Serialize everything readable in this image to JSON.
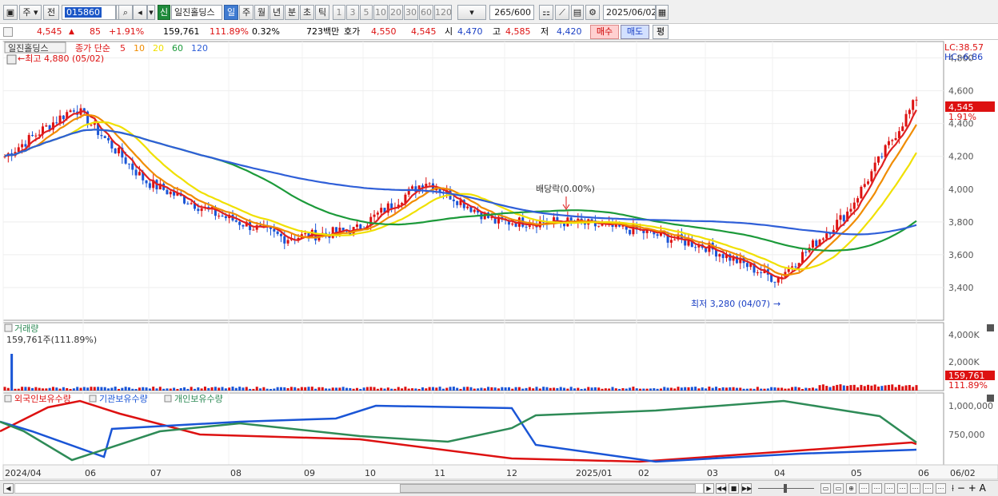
{
  "toolbar": {
    "market": "주",
    "prev_label": "전",
    "code": "015860",
    "name_badge": "신",
    "stock_name": "일진홀딩스",
    "periods": [
      "일",
      "주",
      "월",
      "년",
      "분",
      "초",
      "틱"
    ],
    "active_period": "일",
    "intervals": [
      "1",
      "3",
      "5",
      "10",
      "20",
      "30",
      "60",
      "120"
    ],
    "count": "265/600",
    "date": "2025/06/02"
  },
  "quote": {
    "price": "4,545",
    "change_arrow": "▲",
    "change": "85",
    "change_pct": "+1.91%",
    "volume": "159,761",
    "volume_ratio": "111.89%",
    "turnover": "0.32%",
    "amount": "723백만",
    "ask_label": "호가",
    "ask1": "4,550",
    "ask2": "4,545",
    "open_label": "시",
    "open": "4,470",
    "high_label": "고",
    "high": "4,585",
    "low_label": "저",
    "low": "4,420",
    "buy_label": "매수",
    "sell_label": "매도",
    "eval_label": "평"
  },
  "legend": {
    "stock": "일진홀딩스",
    "ma_title": "종가 단순",
    "ma": [
      {
        "period": "5",
        "color": "#e02020"
      },
      {
        "period": "10",
        "color": "#f08c00"
      },
      {
        "period": "20",
        "color": "#f0e000"
      },
      {
        "period": "60",
        "color": "#1c9a3a"
      },
      {
        "period": "120",
        "color": "#2f5fd8"
      }
    ]
  },
  "annotations": {
    "high": "최고 4,880 (05/02)",
    "low": "최저 3,280 (04/07)",
    "dividend": "배당락(0.00%)",
    "lc": "LC:38.57",
    "hc": "HC:-6.86",
    "price_tag": "4,545",
    "pct_tag": "1.91%"
  },
  "price_axis": [
    "4,800",
    "4,600",
    "4,400",
    "4,200",
    "4,000",
    "3,800",
    "3,600",
    "3,400"
  ],
  "volume_panel": {
    "title": "거래량",
    "value": "159,761주(111.89%)",
    "axis": [
      "4,000K",
      "2,000K"
    ],
    "tag": "159,761",
    "tag2": "111.89%"
  },
  "holding_panel": {
    "series": [
      {
        "name": "외국인보유수량",
        "color": "#d11"
      },
      {
        "name": "기관보유수량",
        "color": "#1a55d6"
      },
      {
        "name": "개인보유수량",
        "color": "#2e8b57"
      }
    ],
    "axis": [
      "1,000,000",
      "750,000"
    ]
  },
  "time_axis": [
    "2024/04",
    "06",
    "07",
    "08",
    "09",
    "10",
    "11",
    "12",
    "2025/01",
    "02",
    "03",
    "04",
    "05",
    "06",
    "06/02"
  ],
  "chart_data": {
    "type": "candlestick",
    "symbol": "일진홀딩스",
    "ylim": [
      3200,
      4900
    ],
    "x": [
      "2024/04",
      "06",
      "07",
      "08",
      "09",
      "10",
      "11",
      "12",
      "2025/01",
      "02",
      "03",
      "04",
      "05",
      "06"
    ],
    "close_approx": [
      4200,
      4500,
      4050,
      3850,
      3700,
      3750,
      4050,
      3800,
      3800,
      3750,
      3650,
      3450,
      3850,
      4545
    ],
    "high_label": {
      "value": 4880,
      "date": "05/02"
    },
    "low_label": {
      "value": 3280,
      "date": "04/07"
    },
    "last": {
      "price": 4545,
      "change_pct": 1.91
    }
  }
}
